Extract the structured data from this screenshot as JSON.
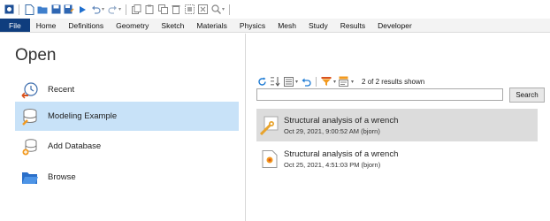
{
  "quick_access": {
    "icons": [
      "app-icon",
      "new-icon",
      "open-icon",
      "save-icon",
      "save-as-icon",
      "run-icon",
      "undo-icon",
      "redo-icon",
      "copy-icon",
      "paste-icon",
      "duplicate-icon",
      "delete-icon",
      "select-all-icon",
      "clear-icon",
      "zoom-icon"
    ]
  },
  "menu": {
    "tabs": [
      "File",
      "Home",
      "Definitions",
      "Geometry",
      "Sketch",
      "Materials",
      "Physics",
      "Mesh",
      "Study",
      "Results",
      "Developer"
    ]
  },
  "left": {
    "title": "Open",
    "items": [
      {
        "label": "Recent",
        "icon": "recent-clock-icon"
      },
      {
        "label": "Modeling Example",
        "icon": "database-icon"
      },
      {
        "label": "Add Database",
        "icon": "add-database-icon"
      },
      {
        "label": "Browse",
        "icon": "folder-icon"
      }
    ],
    "selected_index": 1
  },
  "right": {
    "count_text": "2 of 2 results shown",
    "search": {
      "value": "",
      "button_label": "Search"
    },
    "results": [
      {
        "title": "Structural analysis of a wrench",
        "date": "Oct 29, 2021, 9:00:52 AM (bjorn)"
      },
      {
        "title": "Structural analysis of a wrench",
        "date": "Oct 25, 2021, 4:51:03 PM (bjorn)"
      }
    ],
    "selected_result": 0
  },
  "colors": {
    "file_tab": "#0f3d7e",
    "selected_nav": "#c8e2f8",
    "selected_result": "#dcdcdc",
    "accent_orange": "#f29a1f",
    "accent_blue": "#1e7bd4"
  }
}
